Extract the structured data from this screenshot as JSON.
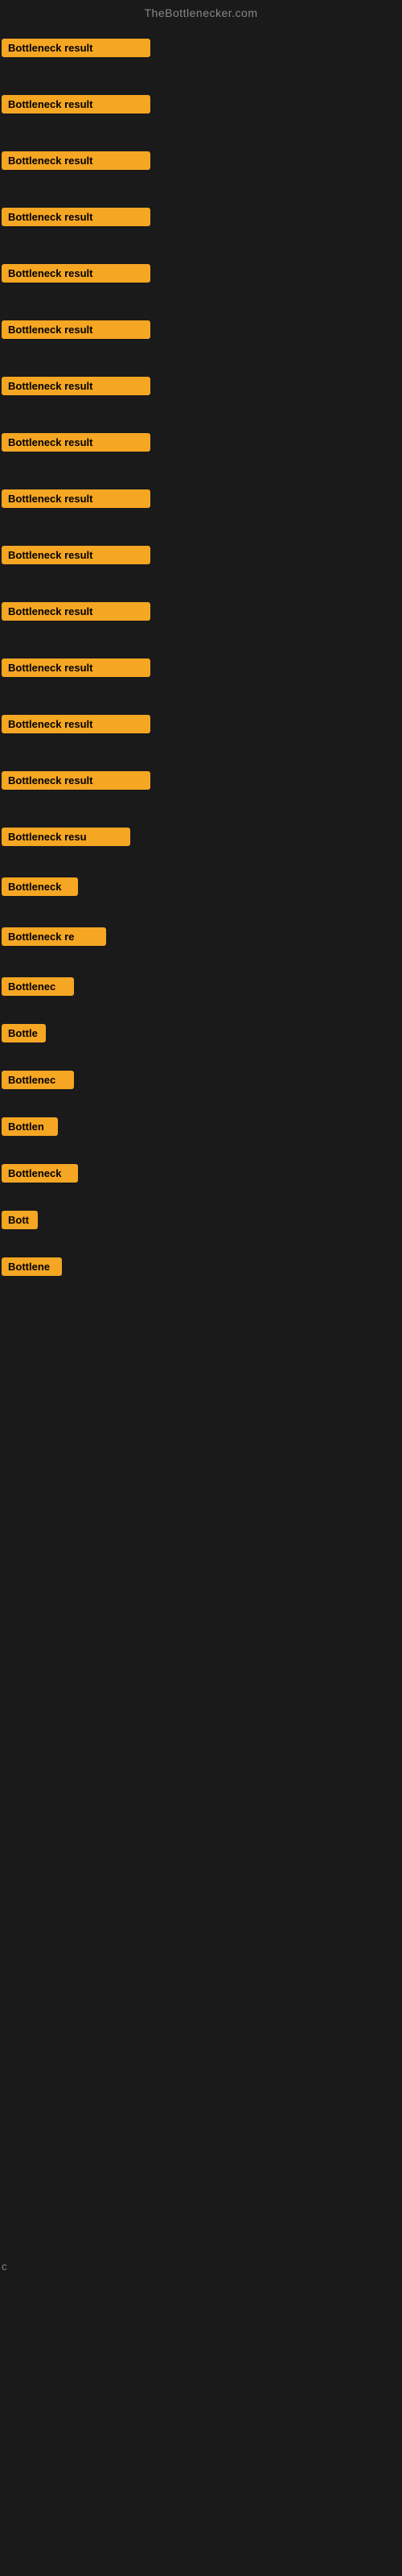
{
  "header": {
    "title": "TheBottlenecker.com"
  },
  "items": [
    {
      "id": 1,
      "label": "Bottleneck result",
      "width": "full"
    },
    {
      "id": 2,
      "label": "Bottleneck result",
      "width": "full"
    },
    {
      "id": 3,
      "label": "Bottleneck result",
      "width": "full"
    },
    {
      "id": 4,
      "label": "Bottleneck result",
      "width": "full"
    },
    {
      "id": 5,
      "label": "Bottleneck result",
      "width": "full"
    },
    {
      "id": 6,
      "label": "Bottleneck result",
      "width": "full"
    },
    {
      "id": 7,
      "label": "Bottleneck result",
      "width": "full"
    },
    {
      "id": 8,
      "label": "Bottleneck result",
      "width": "full"
    },
    {
      "id": 9,
      "label": "Bottleneck result",
      "width": "full"
    },
    {
      "id": 10,
      "label": "Bottleneck result",
      "width": "full"
    },
    {
      "id": 11,
      "label": "Bottleneck result",
      "width": "full"
    },
    {
      "id": 12,
      "label": "Bottleneck result",
      "width": "full"
    },
    {
      "id": 13,
      "label": "Bottleneck result",
      "width": "full"
    },
    {
      "id": 14,
      "label": "Bottleneck result",
      "width": "full"
    },
    {
      "id": 15,
      "label": "Bottleneck resu",
      "width": "truncated1"
    },
    {
      "id": 16,
      "label": "Bottleneck",
      "width": "truncated2"
    },
    {
      "id": 17,
      "label": "Bottleneck re",
      "width": "truncated3"
    },
    {
      "id": 18,
      "label": "Bottlenec",
      "width": "truncated4"
    },
    {
      "id": 19,
      "label": "Bottle",
      "width": "truncated5"
    },
    {
      "id": 20,
      "label": "Bottlenec",
      "width": "truncated4"
    },
    {
      "id": 21,
      "label": "Bottlen",
      "width": "truncated6"
    },
    {
      "id": 22,
      "label": "Bottleneck",
      "width": "truncated2"
    },
    {
      "id": 23,
      "label": "Bott",
      "width": "truncated7"
    },
    {
      "id": 24,
      "label": "Bottlene",
      "width": "truncated8"
    }
  ],
  "footer_char": "c",
  "colors": {
    "badge_bg": "#f5a623",
    "badge_text": "#000000",
    "background": "#1a1a1a",
    "header_text": "#888888"
  }
}
